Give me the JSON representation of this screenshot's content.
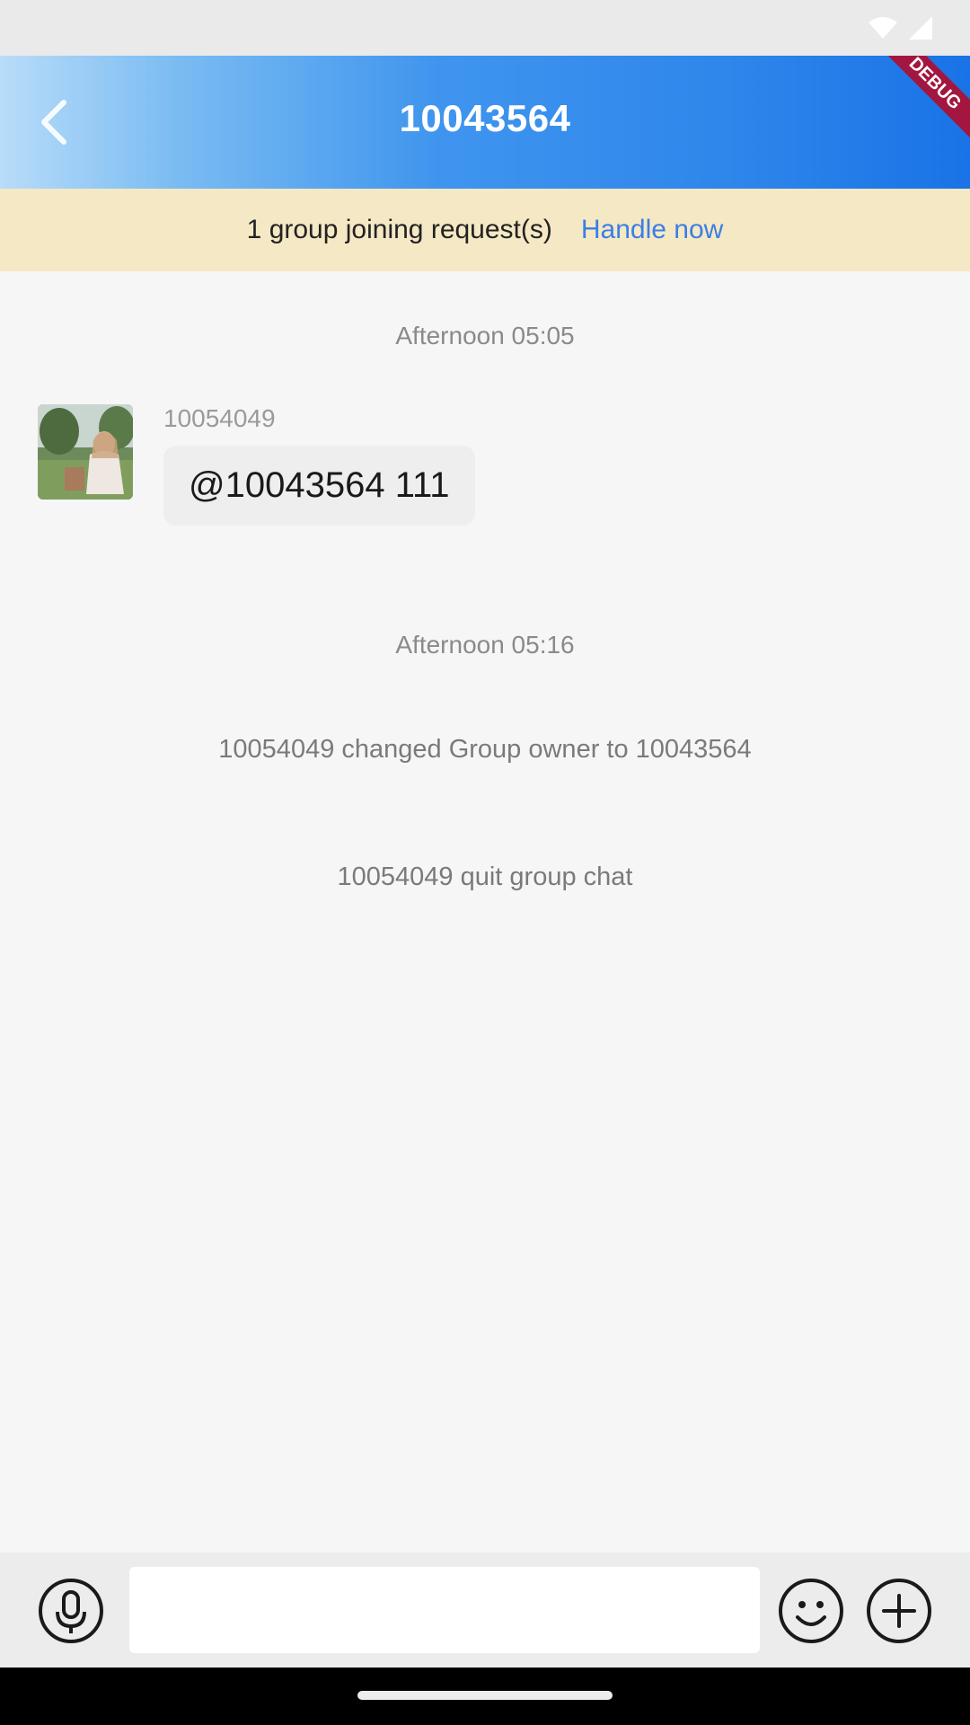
{
  "app_bar": {
    "title": "10043564",
    "debug_label": "DEBUG"
  },
  "join_banner": {
    "text": "1 group joining request(s)",
    "action": "Handle now"
  },
  "messages": {
    "time_1": "Afternoon 05:05",
    "sender": "10054049",
    "bubble_text": "@10043564 111",
    "time_2": "Afternoon 05:16",
    "system_1": "10054049 changed Group owner to  10043564",
    "system_2": "10054049 quit group chat"
  },
  "input": {
    "placeholder": "",
    "icons": {
      "voice": "microphone-icon",
      "emoji": "smiley-icon",
      "more": "plus-icon"
    }
  },
  "colors": {
    "accent": "#3a7fe6",
    "banner_bg": "#f5e8c4",
    "debug_ribbon": "#a3163f"
  }
}
